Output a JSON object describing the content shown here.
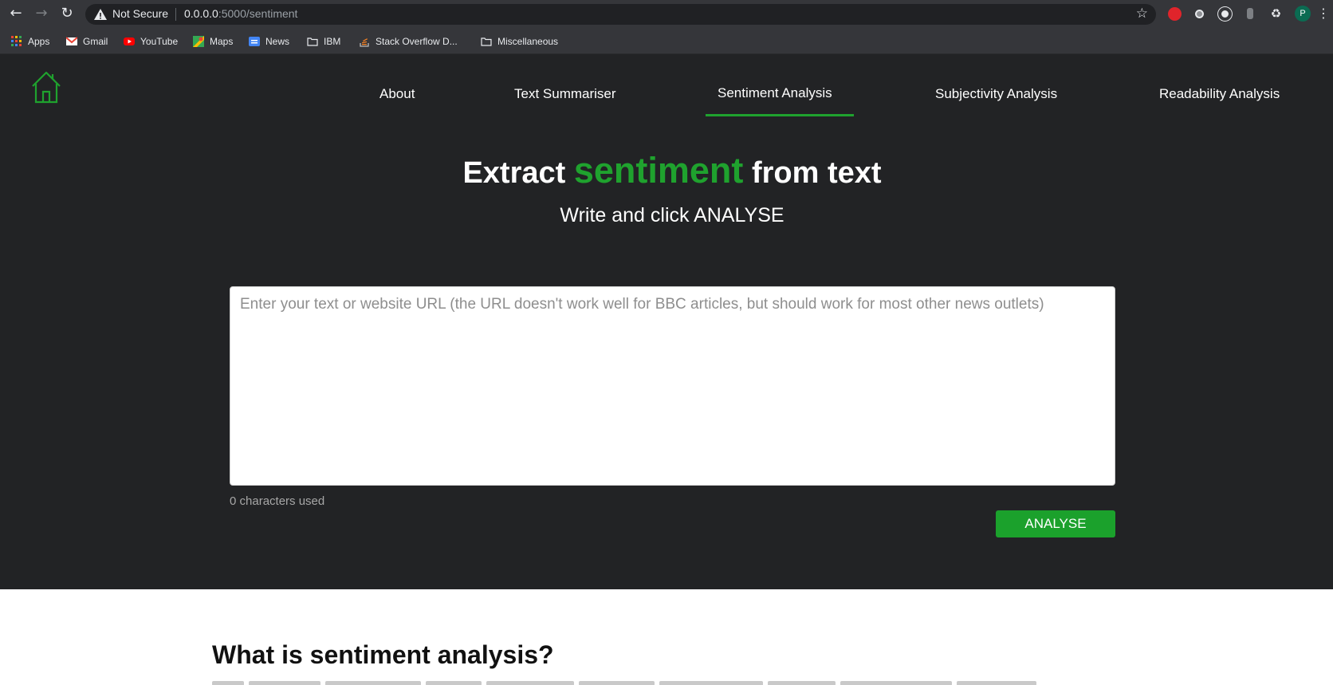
{
  "browser": {
    "security_label": "Not Secure",
    "url_host": "0.0.0.0",
    "url_rest": ":5000/sentiment",
    "profile_initial": "P",
    "bookmarks": [
      {
        "label": "Apps",
        "icon": "apps-grid-icon"
      },
      {
        "label": "Gmail",
        "icon": "gmail-icon"
      },
      {
        "label": "YouTube",
        "icon": "youtube-icon"
      },
      {
        "label": "Maps",
        "icon": "maps-icon"
      },
      {
        "label": "News",
        "icon": "google-news-icon"
      },
      {
        "label": "IBM",
        "icon": "folder-icon"
      },
      {
        "label": "Stack Overflow D...",
        "icon": "stackoverflow-icon"
      },
      {
        "label": "Miscellaneous",
        "icon": "folder-icon"
      }
    ]
  },
  "nav": {
    "items": [
      {
        "label": "About"
      },
      {
        "label": "Text Summariser"
      },
      {
        "label": "Sentiment Analysis",
        "active": true
      },
      {
        "label": "Subjectivity Analysis"
      },
      {
        "label": "Readability Analysis"
      }
    ]
  },
  "hero": {
    "title_before": "Extract ",
    "title_accent": "sentiment",
    "title_after": " from text",
    "subtitle": "Write and click ANALYSE"
  },
  "input": {
    "value": "",
    "placeholder": "Enter your text or website URL (the URL doesn't work well for BBC articles, but should work for most other news outlets)",
    "char_count": "0 characters used"
  },
  "analyse_button": {
    "label": "ANALYSE"
  },
  "info": {
    "title": "What is sentiment analysis?"
  },
  "colors": {
    "accent": "#1fa22e",
    "page_dark": "#222325",
    "chrome": "#35363a"
  }
}
